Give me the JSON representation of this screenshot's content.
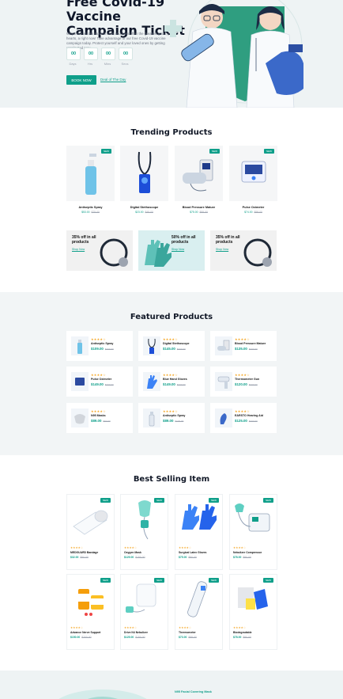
{
  "hero": {
    "title": "Free Covid-19 Vaccine Campaign Ticket",
    "text": "Why more across student tools and uses often the greatest good, your hearts, a right now! Take advantage of our free Covid-19 vaccine campaign today. Protect yourself and your loved ones by getting vaccinated now.",
    "countdown": [
      {
        "value": "00",
        "label": "Days"
      },
      {
        "value": "00",
        "label": "Hrs"
      },
      {
        "value": "00",
        "label": "Mins"
      },
      {
        "value": "00",
        "label": "Secs"
      }
    ],
    "book_button": "BOOK NOW",
    "deal_link": "Deal of The Day"
  },
  "trending": {
    "title": "Trending Products",
    "products": [
      {
        "name": "Antiseptic Spray",
        "price": "$53.00",
        "old_price": "$75.00",
        "badge": "NEW",
        "icon": "spray-bottle-icon"
      },
      {
        "name": "Digital Stethoscope",
        "price": "$23.00",
        "old_price": "$45.00",
        "badge": "",
        "icon": "stethoscope-icon"
      },
      {
        "name": "Blood Pressure Mature",
        "price": "$75.00",
        "old_price": "$95.00",
        "badge": "NEW",
        "icon": "blood-pressure-monitor-icon"
      },
      {
        "name": "Pulse Oximeter",
        "price": "$74.00",
        "old_price": "$98.00",
        "badge": "NEW",
        "icon": "oximeter-icon"
      }
    ],
    "promos": [
      {
        "text": "35% off in all products",
        "link": "Shop Now",
        "bg": "#f1f1f1"
      },
      {
        "text": "50% off in all products",
        "link": "Shop Now",
        "bg": "#d9eff0"
      },
      {
        "text": "35% off in all products",
        "link": "Shop Now",
        "bg": "#f1f1f1"
      }
    ]
  },
  "featured": {
    "title": "Featured Products",
    "products": [
      {
        "name": "Antiseptic Spray",
        "price": "$109.00",
        "old_price": "$200.00",
        "stars": "★★★★☆"
      },
      {
        "name": "Digital Stethoscope",
        "price": "$145.00",
        "old_price": "$200.00",
        "stars": "★★★★☆"
      },
      {
        "name": "Blood Pressure Mature",
        "price": "$135.00",
        "old_price": "$200.00",
        "stars": "★★★★☆"
      },
      {
        "name": "Pulse Oximeter",
        "price": "$149.00",
        "old_price": "$200.00",
        "stars": "★★★★☆"
      },
      {
        "name": "Blue Hand Gloves",
        "price": "$149.00",
        "old_price": "$200.00",
        "stars": "★★★★☆"
      },
      {
        "name": "Thermometer Gun",
        "price": "$120.00",
        "old_price": "$200.00",
        "stars": "★★★★☆"
      },
      {
        "name": "N95 Masks",
        "price": "$89.00",
        "old_price": "$90.00",
        "stars": "★★★★☆"
      },
      {
        "name": "Antiseptic Spray",
        "price": "$89.00",
        "old_price": "$100.00",
        "stars": "★★★★☆"
      },
      {
        "name": "EARSTO Hearing Aid",
        "price": "$125.00",
        "old_price": "$200.00",
        "stars": "★★★★☆"
      }
    ]
  },
  "best": {
    "title": "Best Selling Item",
    "products": [
      {
        "name": "MEDGUARD Bandage",
        "price": "$32.00",
        "old_price": "$50.00",
        "badge": "NEW",
        "stars": "★★★★☆"
      },
      {
        "name": "Oxygen Mask",
        "price": "$129.00",
        "old_price": "$150.00",
        "badge": "NEW",
        "stars": "★★★★☆"
      },
      {
        "name": "Surgical Latex Gloves",
        "price": "$75.00",
        "old_price": "$90.00",
        "badge": "NEW",
        "stars": "★★★★☆"
      },
      {
        "name": "Nebulizer Compressor",
        "price": "$78.00",
        "old_price": "$90.00",
        "badge": "NEW",
        "stars": "★★★★☆"
      },
      {
        "name": "Advance Nerve Support",
        "price": "$150.00",
        "old_price": "$200.00",
        "badge": "NEW",
        "stars": "★★★★☆"
      },
      {
        "name": "Drive N4 Nebulizer",
        "price": "$125.00",
        "old_price": "$150.00",
        "badge": "NEW",
        "stars": "★★★★☆"
      },
      {
        "name": "Thermometer",
        "price": "$73.00",
        "old_price": "$88.00",
        "badge": "NEW",
        "stars": "★★★★☆"
      },
      {
        "name": "Biodegradable",
        "price": "$78.00",
        "old_price": "$90.00",
        "badge": "NEW",
        "stars": "★★★★☆"
      }
    ]
  },
  "bottom": {
    "caption": "N95 Facial Covering Mask"
  },
  "colors": {
    "accent": "#0f9f8a",
    "star": "#f5a623"
  }
}
